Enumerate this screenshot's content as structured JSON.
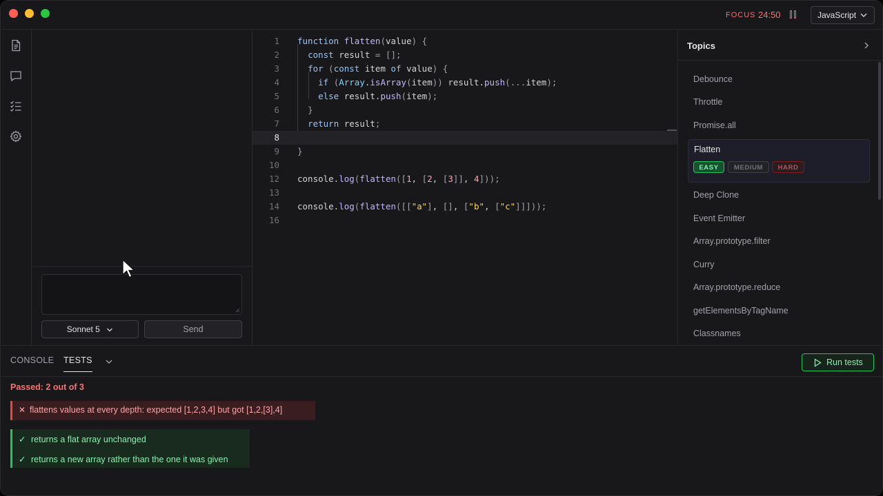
{
  "header": {
    "focus_label": "FOCUS",
    "focus_timer": "24:50",
    "language": "JavaScript"
  },
  "sidebar": {
    "icons": [
      "document-icon",
      "chat-icon",
      "checklist-icon",
      "gear-icon"
    ]
  },
  "chat": {
    "model_label": "Sonnet 5",
    "send_label": "Send",
    "input_value": ""
  },
  "editor": {
    "line_numbers": [
      "1",
      "2",
      "3",
      "4",
      "5",
      "6",
      "7",
      "8",
      "9",
      "10",
      "12",
      "13",
      "14",
      "16"
    ],
    "active_line": "8"
  },
  "topics": {
    "title": "Topics",
    "items": [
      "Debounce",
      "Throttle",
      "Promise.all",
      "Flatten",
      "Deep Clone",
      "Event Emitter",
      "Array.prototype.filter",
      "Curry",
      "Array.prototype.reduce",
      "getElementsByTagName",
      "Classnames"
    ],
    "selected": "Flatten",
    "difficulty": {
      "easy": "EASY",
      "medium": "MEDIUM",
      "hard": "HARD",
      "current": "easy"
    }
  },
  "panel": {
    "tabs": [
      "CONSOLE",
      "TESTS"
    ],
    "active_tab": "TESTS",
    "run_label": "Run tests",
    "summary": "Passed: 2 out of 3",
    "failed": [
      "flattens values at every depth: expected [1,2,3,4] but got [1,2,[3],4]"
    ],
    "passed": [
      "returns a flat array unchanged",
      "returns a new array rather than the one it was given"
    ]
  },
  "colors": {
    "accent_green": "#22c55e",
    "error_red": "#f87171",
    "background": "#18181b"
  }
}
